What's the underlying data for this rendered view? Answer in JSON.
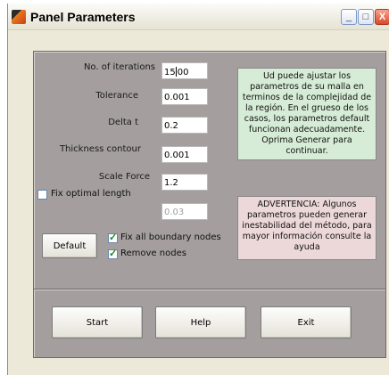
{
  "window": {
    "title": "Panel Parameters",
    "minimize": "_",
    "maximize": "□",
    "close": "X"
  },
  "params": {
    "iterations": {
      "label": "No. of iterations",
      "value_before": "15",
      "value_after": "00"
    },
    "tolerance": {
      "label": "Tolerance",
      "value": "0.001"
    },
    "delta_t": {
      "label": "Delta t",
      "value": "0.2"
    },
    "thickness": {
      "label": "Thickness contour",
      "value": "0.001"
    },
    "scale_force": {
      "label": "Scale Force",
      "value": "1.2"
    },
    "optimal_length": {
      "label": "Fix optimal length",
      "value": "0.03",
      "checked": false
    }
  },
  "checks": {
    "fix_boundary": {
      "label": "Fix all boundary nodes",
      "checked": true
    },
    "remove_nodes": {
      "label": "Remove nodes",
      "checked": true
    }
  },
  "buttons": {
    "default": "Default",
    "start": "Start",
    "help": "Help",
    "exit": "Exit"
  },
  "notes": {
    "info": "Ud puede ajustar los parametros de su malla en terminos de la complejidad de la región. En el grueso de los casos, los parametros default funcionan adecuadamente. Oprima Generar para continuar.",
    "warning": "ADVERTENCIA: Algunos parametros pueden generar inestabilidad del método, para mayor información consulte la ayuda"
  },
  "colors": {
    "panel": "#a49e9e",
    "info_note": "#d6ecd6",
    "warning_note": "#ecd8d8",
    "check_mark": "#1a8a1a"
  }
}
